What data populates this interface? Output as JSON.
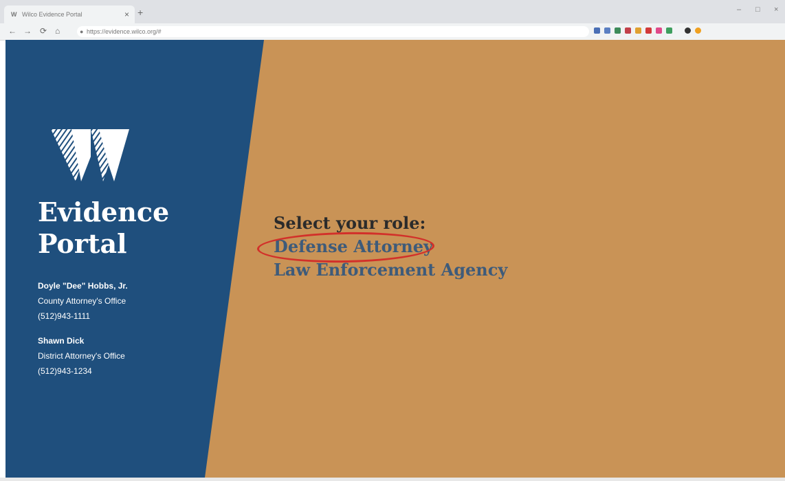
{
  "browser": {
    "tab_title": "Wilco Evidence Portal",
    "tab_favicon": "W",
    "close_tab": "×",
    "new_tab": "+",
    "url": "https://evidence.wilco.org/#",
    "nav": {
      "back": "←",
      "forward": "→",
      "reload": "⟳",
      "home": "⌂"
    },
    "window_controls": {
      "minimize": "–",
      "maximize": "□",
      "close": "×"
    },
    "extension_colors": [
      "#4a6fb5",
      "#5b7fc2",
      "#3d8b5a",
      "#c2404a",
      "#e0a030",
      "#d23a3a",
      "#e04a8a",
      "#3e9e5e",
      "#333333",
      "#f0a020"
    ]
  },
  "sidebar": {
    "logo_letter": "W",
    "brand_line1": "Evidence",
    "brand_line2": "Portal",
    "contacts": [
      {
        "name": "Doyle \"Dee\" Hobbs, Jr.",
        "office": "County Attorney's Office",
        "phone": "(512)943-1111"
      },
      {
        "name": "Shawn Dick",
        "office": "District Attorney's Office",
        "phone": "(512)943-1234"
      }
    ]
  },
  "main": {
    "prompt": "Select your role:",
    "roles": [
      "Defense Attorney",
      "Law Enforcement Agency"
    ],
    "highlighted_role": "Defense Attorney",
    "highlight_color": "#d2302a"
  },
  "colors": {
    "sidebar": "#1f4f7d",
    "background": "#c99356",
    "link": "#3e5b7a"
  }
}
